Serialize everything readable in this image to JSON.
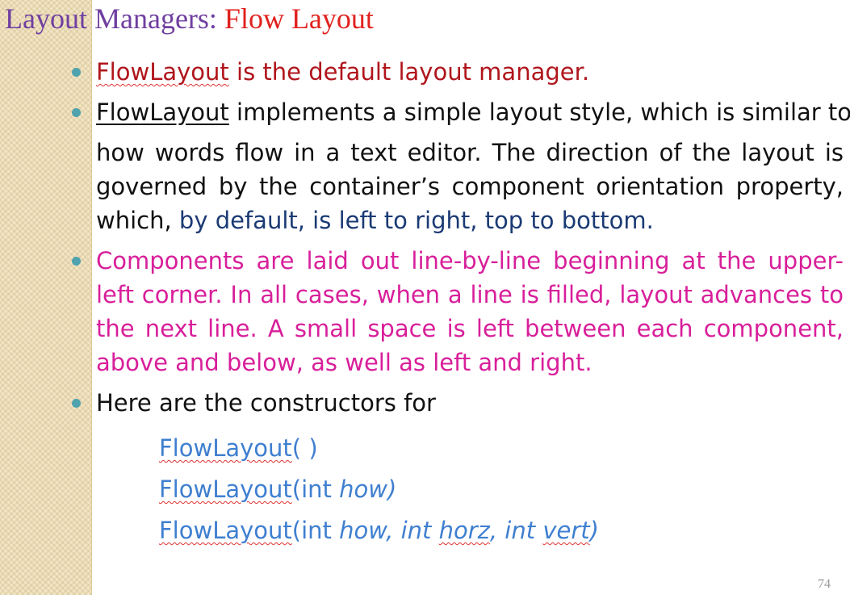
{
  "slide": {
    "title_part1": "Layout Managers: ",
    "title_part2": "Flow Layout",
    "page_number": "74"
  },
  "bullets": {
    "b1": {
      "name": "FlowLayout",
      "rest": " is the default layout manager."
    },
    "b2": {
      "name": "FlowLayout",
      "line1_rest": " implements a simple layout style, which is similar to",
      "para_text": "how words flow in a text editor. The direction of the layout is governed by the container’s component orientation property, which, ",
      "para_blue": "by default, is left to right, top to bottom."
    },
    "b3": {
      "text": "Components are laid out line-by-line beginning at the upper-left corner. In all cases, when a line is filled, layout advances to the next line. A small space is left between each component, above and below, as well as left and right."
    },
    "b4": {
      "text": "Here are the constructors for"
    }
  },
  "constructors": [
    {
      "fn": "FlowLayout",
      "args": "( )"
    },
    {
      "fn": "FlowLayout",
      "open": "(int ",
      "how": "how)"
    },
    {
      "fn": "FlowLayout",
      "open": "(int ",
      "how": "how, int ",
      "horz": "horz",
      "sep": ", int ",
      "vert": "vert",
      "close": ")"
    }
  ],
  "colors": {
    "title_purple": "#6f3fa0",
    "title_red": "#e0211d",
    "bullet1_red": "#b0151c",
    "bullet3_magenta": "#d81f9a",
    "blue_text": "#1b3a74",
    "constructor_blue": "#3f7fd0",
    "bullet_dot": "#4fa3ae"
  }
}
